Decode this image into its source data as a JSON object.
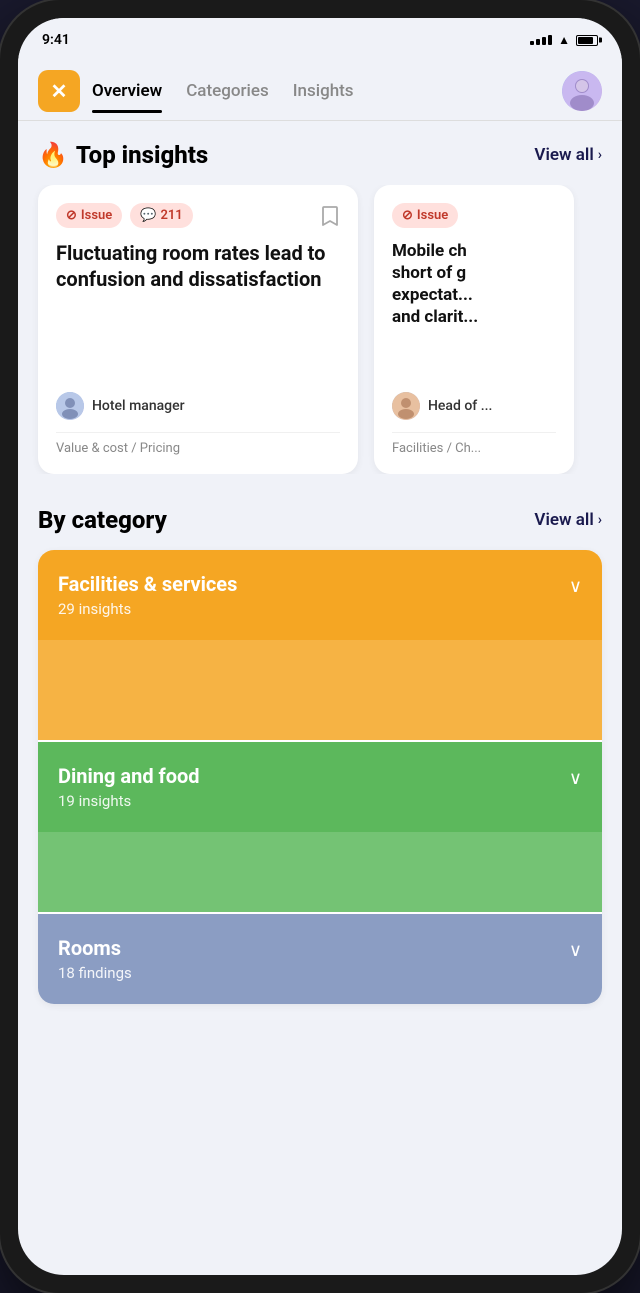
{
  "app": {
    "logo_symbol": "✕",
    "logo_bg": "#F5A623"
  },
  "nav": {
    "tabs": [
      {
        "id": "overview",
        "label": "Overview",
        "active": true
      },
      {
        "id": "categories",
        "label": "Categories",
        "active": false
      },
      {
        "id": "insights",
        "label": "Insights",
        "active": false
      }
    ],
    "avatar_emoji": "👩"
  },
  "top_insights": {
    "title": "Top insights",
    "fire_icon": "🔥",
    "view_all_label": "View all",
    "cards": [
      {
        "tag_issue": "Issue",
        "tag_count": "211",
        "tag_icon_issue": "⊘",
        "tag_icon_count": "💬",
        "title": "Fluctuating room rates lead to confusion and dissatisfaction",
        "author": "Hotel manager",
        "meta": "Value & cost / Pricing"
      },
      {
        "tag_issue": "Issue",
        "title": "Mobile ch... short of g... expectat... and clarit...",
        "author": "Head of ...",
        "meta": "Facilities / Ch..."
      }
    ]
  },
  "by_category": {
    "title": "By category",
    "view_all_label": "View all",
    "categories": [
      {
        "id": "facilities",
        "name": "Facilities & services",
        "count": "29 insights",
        "bg": "#F5A623",
        "expanded": true
      },
      {
        "id": "dining",
        "name": "Dining and food",
        "count": "19 insights",
        "bg": "#5cb85c",
        "expanded": false
      },
      {
        "id": "rooms",
        "name": "Rooms",
        "count": "18 findings",
        "bg": "#8b9dc3",
        "expanded": false
      }
    ]
  }
}
